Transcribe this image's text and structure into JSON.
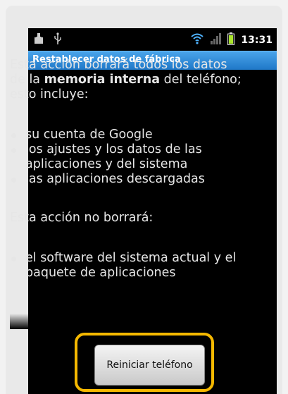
{
  "status_bar": {
    "time": "13:31",
    "icons": [
      "app-download-icon",
      "usb-icon",
      "wifi-icon",
      "signal-icon",
      "battery-icon"
    ]
  },
  "title_bar": {
    "title": "Restablecer datos de fábrica"
  },
  "content": {
    "intro_before": "Esta acción borrará todos los datos de la ",
    "intro_bold": "memoria interna",
    "intro_after": " del teléfono; esto incluye:",
    "erase_items": [
      "su cuenta de Google",
      "los ajustes y los datos de las aplicaciones y del sistema",
      "las aplicaciones descargadas"
    ],
    "not_erase_heading": "Esta acción no borrará:",
    "keep_items": [
      "el software del sistema actual y el paquete de aplicaciones"
    ]
  },
  "button": {
    "label": "Reiniciar teléfono"
  },
  "colors": {
    "title_bar": "#2a86d6",
    "highlight": "#f5b800",
    "background": "#000000"
  }
}
